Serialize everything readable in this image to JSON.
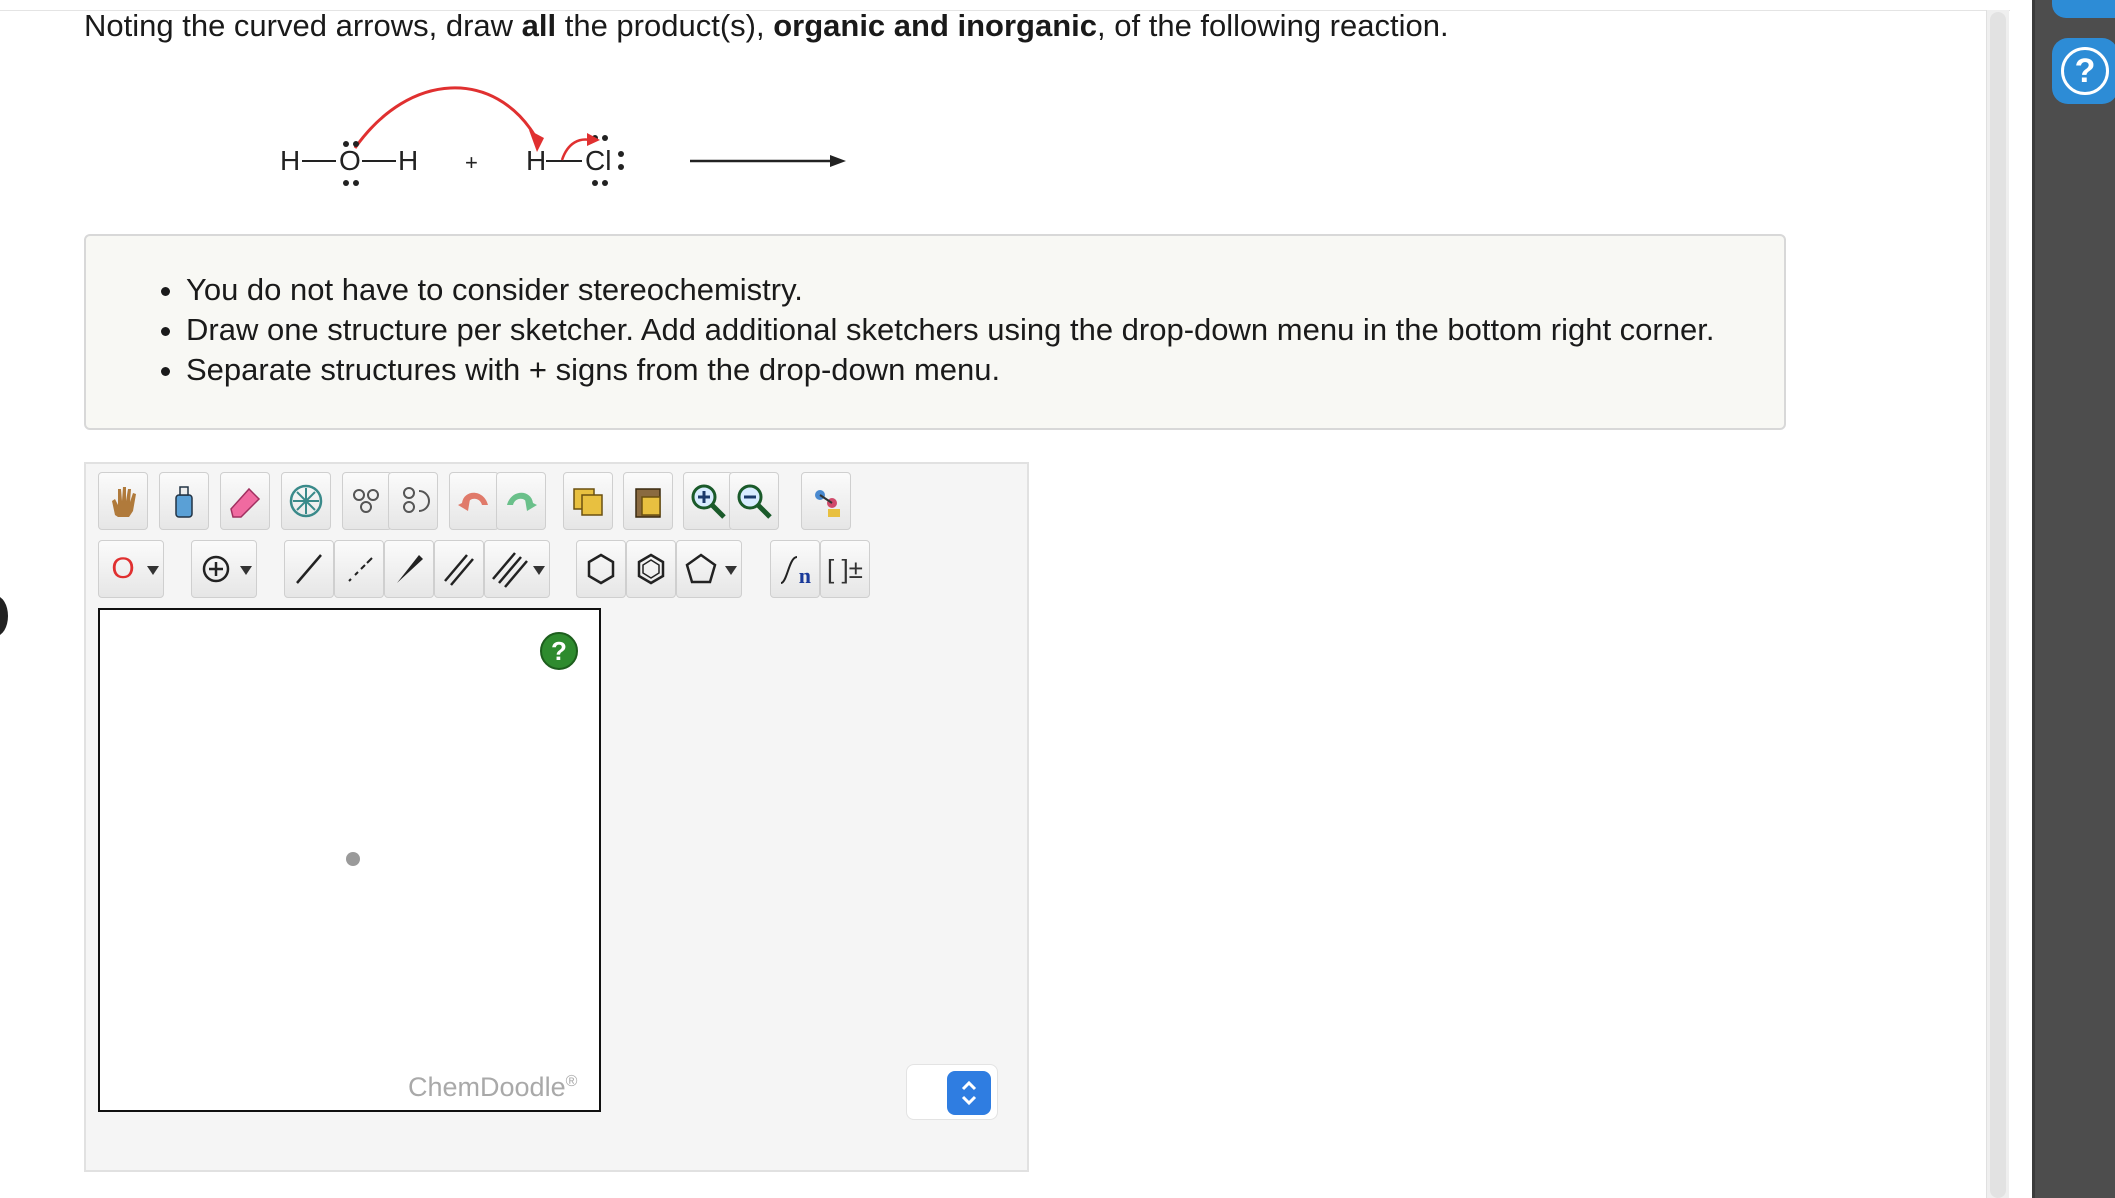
{
  "question": {
    "part1": "Noting the curved arrows, draw ",
    "bold1": "all",
    "part2": " the product(s), ",
    "bold2": "organic and inorganic",
    "part3": ", of the following reaction."
  },
  "reaction": {
    "water_left_h": "H",
    "water_o": "O",
    "water_right_h": "H",
    "plus": "+",
    "hcl_h": "H",
    "hcl_cl": "Cl",
    "arrow_color": "#e03030"
  },
  "instructions": [
    "You do not have to consider stereochemistry.",
    "Draw one structure per sketcher. Add additional sketchers using the drop-down menu in the bottom right corner.",
    "Separate structures with + signs from the drop-down menu."
  ],
  "sketcher": {
    "atom_label": "O",
    "help_label": "?",
    "watermark": "ChemDoodle",
    "watermark_mark": "®",
    "template_label": "[ ]±",
    "chain_label": "n"
  },
  "sidebar": {
    "help_label": "?"
  },
  "colors": {
    "accent": "#2d8cd6",
    "help_green": "#2e8b2e",
    "spinner_blue": "#2f7de1"
  }
}
